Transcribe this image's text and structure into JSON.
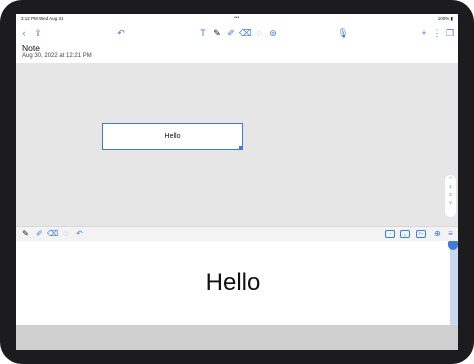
{
  "status_bar": {
    "time": "3:12 PM   Wed Aug 31",
    "dots": "•••",
    "right": "100% ▮"
  },
  "toolbar": {
    "back": "‹",
    "share": "⇪",
    "undo": "↶",
    "text_tool": "T",
    "pen_tool": "✎",
    "marker_tool": "✐",
    "eraser_tool": "⌫",
    "lasso_tool": "◌",
    "shapes_tool": "⊚",
    "mic": "🎙",
    "add": "+",
    "more": "⋮",
    "pages": "❐"
  },
  "note": {
    "title": "Note",
    "date": "Aug 30, 2022 at 12:21 PM"
  },
  "canvas": {
    "textbox_text": "Hello"
  },
  "pager": {
    "up": "^",
    "page_1": "1",
    "page_2": "2",
    "down": "v"
  },
  "bottom_toolbar": {
    "pen": "✎",
    "marker": "✐",
    "eraser": "⌫",
    "lasso": "◌",
    "undo": "↶",
    "back": "‹",
    "space": "␣",
    "convert": "T+",
    "zoom": "⊕",
    "menu": "≡"
  },
  "handwriting": {
    "text": "Hello"
  },
  "colors": {
    "accent": "#3f7bd9",
    "canvas_bg": "#e6e6e6",
    "bezel": "#1c1c1e"
  }
}
